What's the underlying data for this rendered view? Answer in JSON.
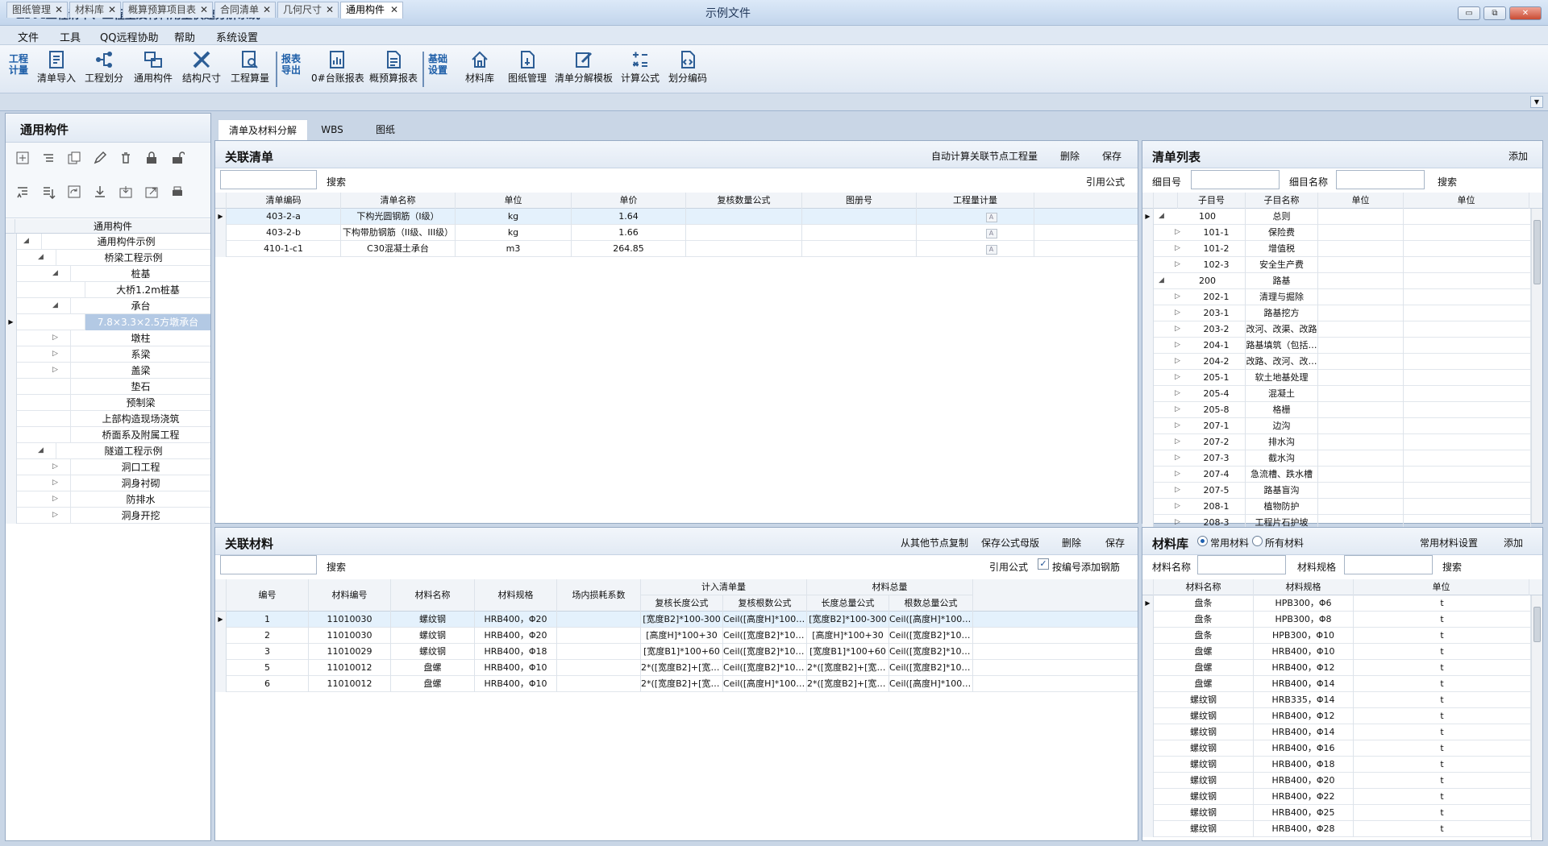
{
  "app": {
    "title": "EPM工程清单、工程量及材料用量快速分解系统",
    "doc_title": "示例文件",
    "win_min": "▭",
    "win_max": "⧉",
    "win_close": "✕"
  },
  "menu": [
    "文件",
    "工具",
    "QQ远程协助",
    "帮助",
    "系统设置"
  ],
  "toolbar": {
    "group1": "工程计量",
    "group2": "报表导出",
    "group3": "基础设置",
    "buttons1": [
      "清单导入",
      "工程划分",
      "通用构件",
      "结构尺寸",
      "工程算量"
    ],
    "buttons2": [
      "0#台账报表",
      "概预算报表"
    ],
    "buttons3": [
      "材料库",
      "图纸管理",
      "清单分解模板",
      "计算公式",
      "划分编码"
    ]
  },
  "doc_tabs": [
    {
      "label": "图纸管理"
    },
    {
      "label": "材料库"
    },
    {
      "label": "概算预算项目表"
    },
    {
      "label": "合同清单"
    },
    {
      "label": "几何尺寸"
    },
    {
      "label": "通用构件"
    }
  ],
  "left": {
    "title": "通用构件",
    "tree_header": "通用构件",
    "tree": [
      {
        "label": "通用构件示例",
        "level": 0,
        "tog": "◢"
      },
      {
        "label": "桥梁工程示例",
        "level": 1,
        "tog": "◢"
      },
      {
        "label": "桩基",
        "level": 2,
        "tog": "◢"
      },
      {
        "label": "大桥1.2m桩基",
        "level": 3,
        "tog": ""
      },
      {
        "label": "承台",
        "level": 2,
        "tog": "◢"
      },
      {
        "label": "7.8×3.3×2.5方墩承台",
        "level": 3,
        "tog": "",
        "selected": true
      },
      {
        "label": "墩柱",
        "level": 2,
        "tog": "▷"
      },
      {
        "label": "系梁",
        "level": 2,
        "tog": "▷"
      },
      {
        "label": "盖梁",
        "level": 2,
        "tog": "▷"
      },
      {
        "label": "垫石",
        "level": 2,
        "tog": ""
      },
      {
        "label": "预制梁",
        "level": 2,
        "tog": ""
      },
      {
        "label": "上部构造现场浇筑",
        "level": 2,
        "tog": ""
      },
      {
        "label": "桥面系及附属工程",
        "level": 2,
        "tog": ""
      },
      {
        "label": "隧道工程示例",
        "level": 1,
        "tog": "◢"
      },
      {
        "label": "洞口工程",
        "level": 2,
        "tog": "▷"
      },
      {
        "label": "洞身衬砌",
        "level": 2,
        "tog": "▷"
      },
      {
        "label": "防排水",
        "level": 2,
        "tog": "▷"
      },
      {
        "label": "洞身开挖",
        "level": 2,
        "tog": "▷"
      }
    ]
  },
  "subtabs": [
    "清单及材料分解",
    "WBS",
    "图纸"
  ],
  "rel_list": {
    "title": "关联清单",
    "actions": [
      "自动计算关联节点工程量",
      "删除",
      "保存"
    ],
    "search": "搜索",
    "ref_formula": "引用公式",
    "columns": [
      "清单编码",
      "清单名称",
      "单位",
      "单价",
      "复核数量公式",
      "图册号",
      "工程量计量"
    ],
    "rows": [
      [
        "403-2-a",
        "下构光圆钢筋（I级）",
        "kg",
        "1.64",
        "",
        "",
        ""
      ],
      [
        "403-2-b",
        "下构带肋钢筋（II级、III级）",
        "kg",
        "1.66",
        "",
        "",
        ""
      ],
      [
        "410-1-c1",
        "C30混凝土承台",
        "m3",
        "264.85",
        "",
        "",
        ""
      ]
    ]
  },
  "item_list": {
    "title": "清单列表",
    "add": "添加",
    "label_code": "细目号",
    "label_name": "细目名称",
    "search": "搜索",
    "columns": [
      "子目号",
      "子目名称",
      "单位",
      "单位"
    ],
    "rows": [
      {
        "code": "100",
        "name": "总则",
        "tog": "◢",
        "lvl": 0
      },
      {
        "code": "101-1",
        "name": "保险费",
        "tog": "▷",
        "lvl": 1
      },
      {
        "code": "101-2",
        "name": "增值税",
        "tog": "▷",
        "lvl": 1
      },
      {
        "code": "102-3",
        "name": "安全生产费",
        "tog": "▷",
        "lvl": 1
      },
      {
        "code": "200",
        "name": "路基",
        "tog": "◢",
        "lvl": 0
      },
      {
        "code": "202-1",
        "name": "清理与掘除",
        "tog": "▷",
        "lvl": 1
      },
      {
        "code": "203-1",
        "name": "路基挖方",
        "tog": "▷",
        "lvl": 1
      },
      {
        "code": "203-2",
        "name": "改河、改渠、改路",
        "tog": "▷",
        "lvl": 1
      },
      {
        "code": "204-1",
        "name": "路基填筑（包括…",
        "tog": "▷",
        "lvl": 1
      },
      {
        "code": "204-2",
        "name": "改路、改河、改…",
        "tog": "▷",
        "lvl": 1
      },
      {
        "code": "205-1",
        "name": "软土地基处理",
        "tog": "▷",
        "lvl": 1
      },
      {
        "code": "205-4",
        "name": "混凝土",
        "tog": "▷",
        "lvl": 1
      },
      {
        "code": "205-8",
        "name": "格栅",
        "tog": "▷",
        "lvl": 1
      },
      {
        "code": "207-1",
        "name": "边沟",
        "tog": "▷",
        "lvl": 1
      },
      {
        "code": "207-2",
        "name": "排水沟",
        "tog": "▷",
        "lvl": 1
      },
      {
        "code": "207-3",
        "name": "截水沟",
        "tog": "▷",
        "lvl": 1
      },
      {
        "code": "207-4",
        "name": "急流槽、跌水槽",
        "tog": "▷",
        "lvl": 1
      },
      {
        "code": "207-5",
        "name": "路基盲沟",
        "tog": "▷",
        "lvl": 1
      },
      {
        "code": "208-1",
        "name": "植物防护",
        "tog": "▷",
        "lvl": 1
      },
      {
        "code": "208-3",
        "name": "工程片石护坡",
        "tog": "▷",
        "lvl": 1
      }
    ]
  },
  "rel_mat": {
    "title": "关联材料",
    "actions": [
      "从其他节点复制",
      "保存公式母版",
      "删除",
      "保存"
    ],
    "search": "搜索",
    "ref_formula": "引用公式",
    "add_rebar": "按编号添加钢筋",
    "group_headers": [
      "计入清单量",
      "材料总量"
    ],
    "columns": [
      "编号",
      "材料编号",
      "材料名称",
      "材料规格",
      "场内损耗系数",
      "复核长度公式",
      "复核根数公式",
      "长度总量公式",
      "根数总量公式"
    ],
    "rows": [
      [
        "1",
        "11010030",
        "螺纹钢",
        "HRB400，Φ20",
        "",
        "[宽度B2]*100-300",
        "Ceil([高度H]*100/…",
        "[宽度B2]*100-300",
        "Ceil([高度H]*100/…"
      ],
      [
        "2",
        "11010030",
        "螺纹钢",
        "HRB400，Φ20",
        "",
        "[高度H]*100+30",
        "Ceil([宽度B2]*100…",
        "[高度H]*100+30",
        "Ceil([宽度B2]*100…"
      ],
      [
        "3",
        "11010029",
        "螺纹钢",
        "HRB400，Φ18",
        "",
        "[宽度B1]*100+60",
        "Ceil([宽度B2]*100…",
        "[宽度B1]*100+60",
        "Ceil([宽度B2]*100…"
      ],
      [
        "5",
        "11010012",
        "盘螺",
        "HRB400，Φ10",
        "",
        "2*([宽度B2]+[宽度…",
        "Ceil([宽度B2]*100…",
        "2*([宽度B2]+[宽度…",
        "Ceil([宽度B2]*100…"
      ],
      [
        "6",
        "11010012",
        "盘螺",
        "HRB400，Φ10",
        "",
        "2*([宽度B2]+[宽度…",
        "Ceil([高度H]*100/…",
        "2*([宽度B2]+[宽度…",
        "Ceil([高度H]*100/…"
      ]
    ]
  },
  "mat_lib": {
    "title": "材料库",
    "radio1": "常用材料",
    "radio2": "所有材料",
    "settings": "常用材料设置",
    "add": "添加",
    "label_name": "材料名称",
    "label_spec": "材料规格",
    "search": "搜索",
    "columns": [
      "材料名称",
      "材料规格",
      "单位"
    ],
    "rows": [
      [
        "盘条",
        "HPB300，Φ6",
        "t"
      ],
      [
        "盘条",
        "HPB300，Φ8",
        "t"
      ],
      [
        "盘条",
        "HPB300，Φ10",
        "t"
      ],
      [
        "盘螺",
        "HRB400，Φ10",
        "t"
      ],
      [
        "盘螺",
        "HRB400，Φ12",
        "t"
      ],
      [
        "盘螺",
        "HRB400，Φ14",
        "t"
      ],
      [
        "螺纹钢",
        "HRB335，Φ14",
        "t"
      ],
      [
        "螺纹钢",
        "HRB400，Φ12",
        "t"
      ],
      [
        "螺纹钢",
        "HRB400，Φ14",
        "t"
      ],
      [
        "螺纹钢",
        "HRB400，Φ16",
        "t"
      ],
      [
        "螺纹钢",
        "HRB400，Φ18",
        "t"
      ],
      [
        "螺纹钢",
        "HRB400，Φ20",
        "t"
      ],
      [
        "螺纹钢",
        "HRB400，Φ22",
        "t"
      ],
      [
        "螺纹钢",
        "HRB400，Φ25",
        "t"
      ],
      [
        "螺纹钢",
        "HRB400，Φ28",
        "t"
      ]
    ]
  }
}
